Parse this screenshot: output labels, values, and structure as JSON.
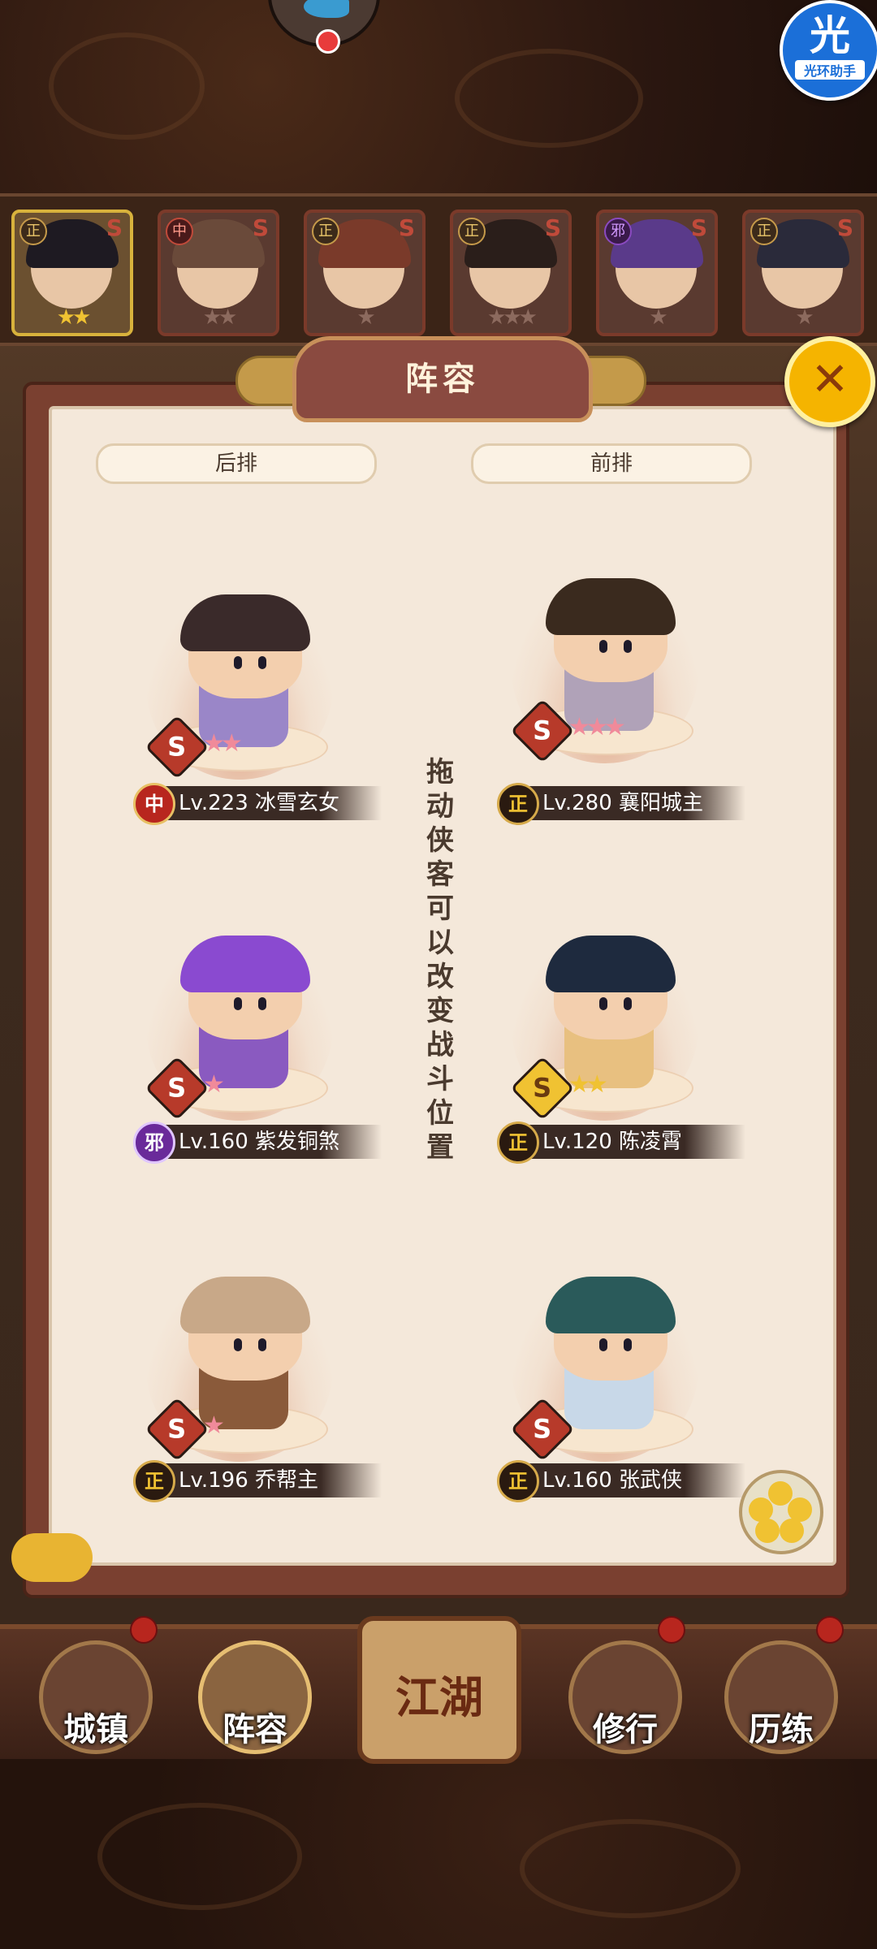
{
  "helper": {
    "icon_char": "光",
    "label": "光环助手"
  },
  "strip": {
    "cards": [
      {
        "faction": "正",
        "stars_on": 2,
        "stars_total": 2,
        "selected": true,
        "hair": "#1e1a22"
      },
      {
        "faction": "中",
        "stars_on": 0,
        "stars_total": 2,
        "selected": false,
        "hair": "#6a4a3a"
      },
      {
        "faction": "正",
        "stars_on": 0,
        "stars_total": 1,
        "selected": false,
        "hair": "#7a3a2a"
      },
      {
        "faction": "正",
        "stars_on": 0,
        "stars_total": 3,
        "selected": false,
        "hair": "#2a1e1a"
      },
      {
        "faction": "邪",
        "stars_on": 0,
        "stars_total": 1,
        "selected": false,
        "hair": "#5a3a8a"
      },
      {
        "faction": "正",
        "stars_on": 0,
        "stars_total": 1,
        "selected": false,
        "hair": "#2a2a3a"
      }
    ]
  },
  "panel": {
    "title": "阵容",
    "back_row_label": "后排",
    "front_row_label": "前排",
    "hint": "拖动侠客可以改变战斗位置"
  },
  "heroes": [
    {
      "slot": "back-1",
      "faction": "中",
      "level": "Lv.223",
      "name": "冰雪玄女",
      "stars": 2,
      "star_color": "pk",
      "s_gold": false,
      "hair": "#3a2a2a",
      "body": "#9a86c8"
    },
    {
      "slot": "front-1",
      "faction": "正",
      "level": "Lv.280",
      "name": "襄阳城主",
      "stars": 3,
      "star_color": "pk",
      "s_gold": false,
      "hair": "#3a2a1e",
      "body": "#b0a2b8"
    },
    {
      "slot": "back-2",
      "faction": "邪",
      "level": "Lv.160",
      "name": "紫发铜煞",
      "stars": 1,
      "star_color": "pk",
      "s_gold": false,
      "hair": "#8a4ad0",
      "body": "#8a5ac0"
    },
    {
      "slot": "front-2",
      "faction": "正",
      "level": "Lv.120",
      "name": "陈凌霄",
      "stars": 2,
      "star_color": "gd",
      "s_gold": true,
      "hair": "#1e2a3e",
      "body": "#e8c080"
    },
    {
      "slot": "back-3",
      "faction": "正",
      "level": "Lv.196",
      "name": "乔帮主",
      "stars": 1,
      "star_color": "pk",
      "s_gold": false,
      "hair": "#c8a888",
      "body": "#8a5a3a"
    },
    {
      "slot": "front-3",
      "faction": "正",
      "level": "Lv.160",
      "name": "张武侠",
      "stars": 0,
      "star_color": "pk",
      "s_gold": false,
      "hair": "#2a5a5a",
      "body": "#c8d8e8"
    }
  ],
  "nav": {
    "items": [
      "城镇",
      "阵容",
      "江湖",
      "修行",
      "历练"
    ],
    "active": "阵容"
  },
  "colors": {
    "accent": "#f0c232",
    "panel_bg": "#f4e8da",
    "frame": "#7a4030"
  }
}
